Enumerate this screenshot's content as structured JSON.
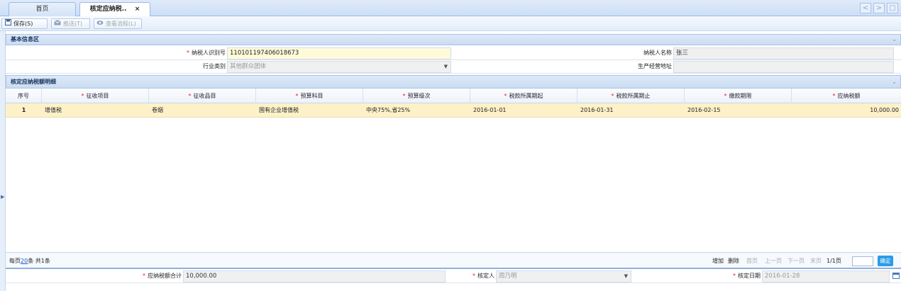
{
  "tabs": [
    {
      "label": "首页"
    },
    {
      "label": "核定应纳税..",
      "close": "×"
    }
  ],
  "nav": {
    "prev": "<",
    "next": ">",
    "max": "□"
  },
  "toolbar": {
    "save_label": "保存(S)",
    "send_label": "推送(T)",
    "flow_label": "查看流程(L)"
  },
  "basic": {
    "title": "基本信息区",
    "taxpayer_id_label": "纳税人识别号",
    "taxpayer_id_value": "110101197406018673",
    "taxpayer_name_label": "纳税人名称",
    "taxpayer_name_value": "张三",
    "industry_label": "行业类别",
    "industry_value": "其他群众团体",
    "address_label": "生产经营地址",
    "address_value": ""
  },
  "detail": {
    "title": "核定应纳税额明细",
    "columns": [
      "序号",
      "征收项目",
      "征收品目",
      "预算科目",
      "预算级次",
      "税款所属期起",
      "税款所属期止",
      "缴款期限",
      "应纳税额"
    ],
    "required_columns": [
      false,
      true,
      true,
      true,
      true,
      true,
      true,
      true,
      true
    ],
    "rows": [
      [
        "1",
        "增值税",
        "卷烟",
        "国有企业增值税",
        "中央75%,省25%",
        "2016-01-01",
        "2016-01-31",
        "2016-02-15",
        "10,000.00"
      ]
    ]
  },
  "pager": {
    "prefix": "每页",
    "page_size": "20",
    "suffix": "条 共1条",
    "add": "增加",
    "delete": "删除",
    "first": "首页",
    "prev": "上一页",
    "next": "下一页",
    "last": "末页",
    "page_info": "1/1页",
    "go": "确定"
  },
  "footer": {
    "total_label": "应纳税额合计",
    "total_value": "10,000.00",
    "assessor_label": "核定人",
    "assessor_value": "周乃明",
    "date_label": "核定日期",
    "date_value": "2016-01-28"
  },
  "colors": {
    "required": "#e0242a",
    "selected_row": "#fdf1c8",
    "accent": "#2a9be6"
  }
}
